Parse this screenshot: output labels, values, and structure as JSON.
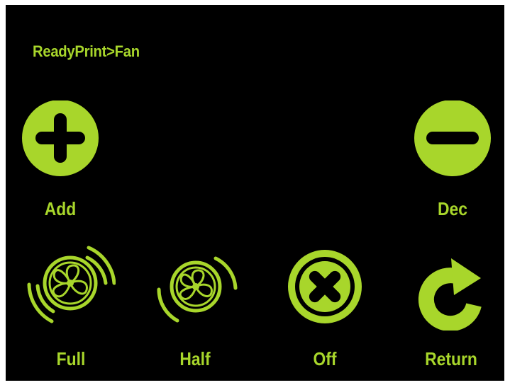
{
  "header": {
    "breadcrumb": "ReadyPrint>Fan"
  },
  "buttons": {
    "add": {
      "label": "Add",
      "icon": "plus-circle-icon"
    },
    "dec": {
      "label": "Dec",
      "icon": "minus-circle-icon"
    },
    "full": {
      "label": "Full",
      "icon": "fan-full-icon"
    },
    "half": {
      "label": "Half",
      "icon": "fan-half-icon"
    },
    "off": {
      "label": "Off",
      "icon": "close-circle-icon"
    },
    "return": {
      "label": "Return",
      "icon": "return-arrow-icon"
    }
  },
  "colors": {
    "background": "#000000",
    "accent": "#a8d62b"
  }
}
